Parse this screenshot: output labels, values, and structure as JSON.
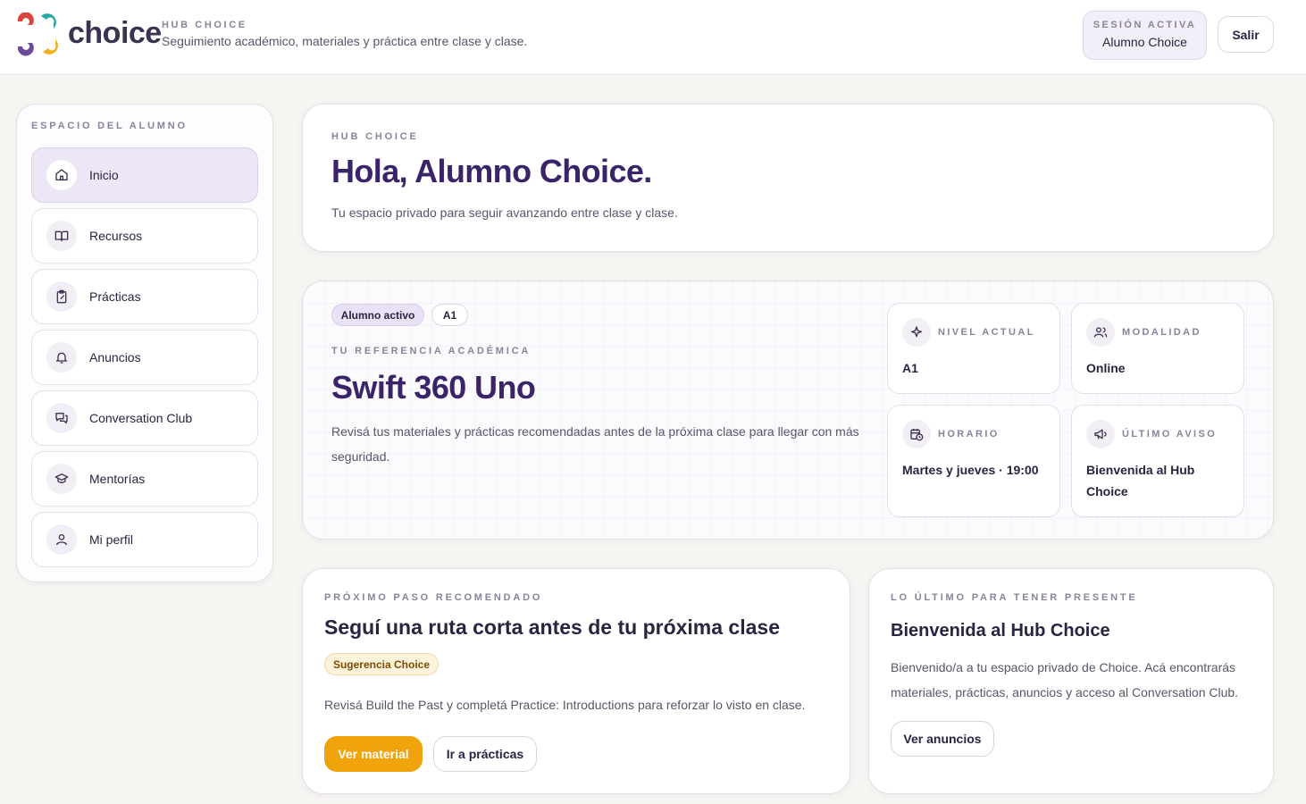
{
  "header": {
    "brand": "choice",
    "hub_eyebrow": "HUB CHOICE",
    "hub_subtitle": "Seguimiento académico, materiales y práctica entre clase y clase.",
    "session_eyebrow": "SESIÓN ACTIVA",
    "session_user": "Alumno Choice",
    "logout_label": "Salir"
  },
  "sidebar": {
    "eyebrow": "ESPACIO DEL ALUMNO",
    "items": [
      {
        "label": "Inicio",
        "icon": "home-icon",
        "active": true
      },
      {
        "label": "Recursos",
        "icon": "book-icon"
      },
      {
        "label": "Prácticas",
        "icon": "clipboard-icon"
      },
      {
        "label": "Anuncios",
        "icon": "bell-icon"
      },
      {
        "label": "Conversation Club",
        "icon": "chat-icon"
      },
      {
        "label": "Mentorías",
        "icon": "graduation-cap-icon"
      },
      {
        "label": "Mi perfil",
        "icon": "user-icon"
      }
    ]
  },
  "hero": {
    "eyebrow": "HUB CHOICE",
    "title": "Hola, Alumno Choice.",
    "subtitle": "Tu espacio privado para seguir avanzando entre clase y clase."
  },
  "reference": {
    "status_pill": "Alumno activo",
    "level_pill": "A1",
    "eyebrow": "TU REFERENCIA ACADÉMICA",
    "title": "Swift 360 Uno",
    "description": "Revisá tus materiales y prácticas recomendadas antes de la próxima clase para llegar con más seguridad.",
    "info": [
      {
        "label": "NIVEL ACTUAL",
        "value": "A1",
        "icon": "sparkles-icon"
      },
      {
        "label": "MODALIDAD",
        "value": "Online",
        "icon": "users-icon"
      },
      {
        "label": "HORARIO",
        "value": "Martes y jueves · 19:00",
        "icon": "calendar-clock-icon"
      },
      {
        "label": "ÚLTIMO AVISO",
        "value": "Bienvenida al Hub Choice",
        "icon": "megaphone-icon"
      }
    ]
  },
  "next_step": {
    "eyebrow": "PRÓXIMO PASO RECOMENDADO",
    "title": "Seguí una ruta corta antes de tu próxima clase",
    "tag": "Sugerencia Choice",
    "text": "Revisá Build the Past y completá Practice: Introductions para reforzar lo visto en clase.",
    "primary_button": "Ver material",
    "secondary_button": "Ir a prácticas"
  },
  "latest": {
    "eyebrow": "LO ÚLTIMO PARA TENER PRESENTE",
    "title": "Bienvenida al Hub Choice",
    "text": "Bienvenido/a a tu espacio privado de Choice. Acá encontrarás materiales, prácticas, anuncios y acceso al Conversation Club.",
    "button": "Ver anuncios"
  },
  "colors": {
    "accent_purple": "#3a2369",
    "accent_amber": "#f0a30a",
    "logo_red": "#d9453b",
    "logo_teal": "#2aa6a3",
    "logo_purple": "#6b4b9a",
    "logo_yellow": "#f2b11d"
  }
}
